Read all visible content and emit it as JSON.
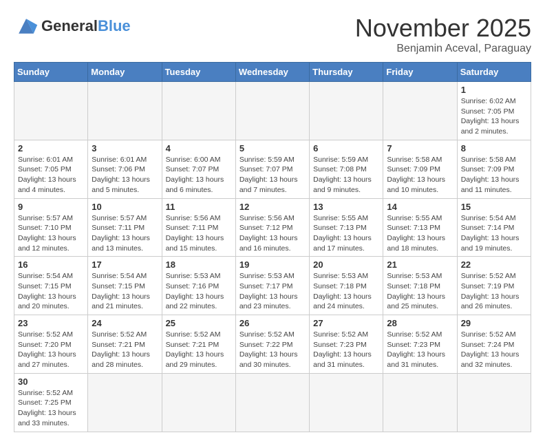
{
  "logo": {
    "general": "General",
    "blue": "Blue"
  },
  "header": {
    "month_year": "November 2025",
    "subtitle": "Benjamin Aceval, Paraguay"
  },
  "weekdays": [
    "Sunday",
    "Monday",
    "Tuesday",
    "Wednesday",
    "Thursday",
    "Friday",
    "Saturday"
  ],
  "weeks": [
    [
      {
        "day": null,
        "info": null
      },
      {
        "day": null,
        "info": null
      },
      {
        "day": null,
        "info": null
      },
      {
        "day": null,
        "info": null
      },
      {
        "day": null,
        "info": null
      },
      {
        "day": null,
        "info": null
      },
      {
        "day": "1",
        "info": "Sunrise: 6:02 AM\nSunset: 7:05 PM\nDaylight: 13 hours and 2 minutes."
      }
    ],
    [
      {
        "day": "2",
        "info": "Sunrise: 6:01 AM\nSunset: 7:05 PM\nDaylight: 13 hours and 4 minutes."
      },
      {
        "day": "3",
        "info": "Sunrise: 6:01 AM\nSunset: 7:06 PM\nDaylight: 13 hours and 5 minutes."
      },
      {
        "day": "4",
        "info": "Sunrise: 6:00 AM\nSunset: 7:07 PM\nDaylight: 13 hours and 6 minutes."
      },
      {
        "day": "5",
        "info": "Sunrise: 5:59 AM\nSunset: 7:07 PM\nDaylight: 13 hours and 7 minutes."
      },
      {
        "day": "6",
        "info": "Sunrise: 5:59 AM\nSunset: 7:08 PM\nDaylight: 13 hours and 9 minutes."
      },
      {
        "day": "7",
        "info": "Sunrise: 5:58 AM\nSunset: 7:09 PM\nDaylight: 13 hours and 10 minutes."
      },
      {
        "day": "8",
        "info": "Sunrise: 5:58 AM\nSunset: 7:09 PM\nDaylight: 13 hours and 11 minutes."
      }
    ],
    [
      {
        "day": "9",
        "info": "Sunrise: 5:57 AM\nSunset: 7:10 PM\nDaylight: 13 hours and 12 minutes."
      },
      {
        "day": "10",
        "info": "Sunrise: 5:57 AM\nSunset: 7:11 PM\nDaylight: 13 hours and 13 minutes."
      },
      {
        "day": "11",
        "info": "Sunrise: 5:56 AM\nSunset: 7:11 PM\nDaylight: 13 hours and 15 minutes."
      },
      {
        "day": "12",
        "info": "Sunrise: 5:56 AM\nSunset: 7:12 PM\nDaylight: 13 hours and 16 minutes."
      },
      {
        "day": "13",
        "info": "Sunrise: 5:55 AM\nSunset: 7:13 PM\nDaylight: 13 hours and 17 minutes."
      },
      {
        "day": "14",
        "info": "Sunrise: 5:55 AM\nSunset: 7:13 PM\nDaylight: 13 hours and 18 minutes."
      },
      {
        "day": "15",
        "info": "Sunrise: 5:54 AM\nSunset: 7:14 PM\nDaylight: 13 hours and 19 minutes."
      }
    ],
    [
      {
        "day": "16",
        "info": "Sunrise: 5:54 AM\nSunset: 7:15 PM\nDaylight: 13 hours and 20 minutes."
      },
      {
        "day": "17",
        "info": "Sunrise: 5:54 AM\nSunset: 7:15 PM\nDaylight: 13 hours and 21 minutes."
      },
      {
        "day": "18",
        "info": "Sunrise: 5:53 AM\nSunset: 7:16 PM\nDaylight: 13 hours and 22 minutes."
      },
      {
        "day": "19",
        "info": "Sunrise: 5:53 AM\nSunset: 7:17 PM\nDaylight: 13 hours and 23 minutes."
      },
      {
        "day": "20",
        "info": "Sunrise: 5:53 AM\nSunset: 7:18 PM\nDaylight: 13 hours and 24 minutes."
      },
      {
        "day": "21",
        "info": "Sunrise: 5:53 AM\nSunset: 7:18 PM\nDaylight: 13 hours and 25 minutes."
      },
      {
        "day": "22",
        "info": "Sunrise: 5:52 AM\nSunset: 7:19 PM\nDaylight: 13 hours and 26 minutes."
      }
    ],
    [
      {
        "day": "23",
        "info": "Sunrise: 5:52 AM\nSunset: 7:20 PM\nDaylight: 13 hours and 27 minutes."
      },
      {
        "day": "24",
        "info": "Sunrise: 5:52 AM\nSunset: 7:21 PM\nDaylight: 13 hours and 28 minutes."
      },
      {
        "day": "25",
        "info": "Sunrise: 5:52 AM\nSunset: 7:21 PM\nDaylight: 13 hours and 29 minutes."
      },
      {
        "day": "26",
        "info": "Sunrise: 5:52 AM\nSunset: 7:22 PM\nDaylight: 13 hours and 30 minutes."
      },
      {
        "day": "27",
        "info": "Sunrise: 5:52 AM\nSunset: 7:23 PM\nDaylight: 13 hours and 31 minutes."
      },
      {
        "day": "28",
        "info": "Sunrise: 5:52 AM\nSunset: 7:23 PM\nDaylight: 13 hours and 31 minutes."
      },
      {
        "day": "29",
        "info": "Sunrise: 5:52 AM\nSunset: 7:24 PM\nDaylight: 13 hours and 32 minutes."
      }
    ],
    [
      {
        "day": "30",
        "info": "Sunrise: 5:52 AM\nSunset: 7:25 PM\nDaylight: 13 hours and 33 minutes."
      },
      {
        "day": null,
        "info": null
      },
      {
        "day": null,
        "info": null
      },
      {
        "day": null,
        "info": null
      },
      {
        "day": null,
        "info": null
      },
      {
        "day": null,
        "info": null
      },
      {
        "day": null,
        "info": null
      }
    ]
  ]
}
